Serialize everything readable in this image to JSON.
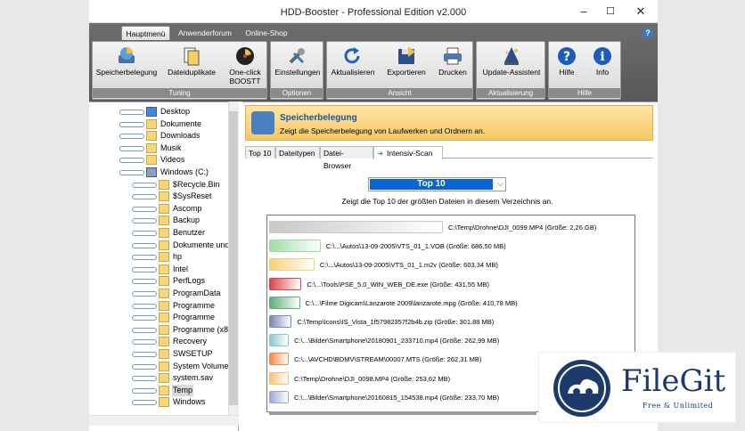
{
  "window": {
    "title": "HDD-Booster - Professional Edition v2.000",
    "minimize": "–",
    "maximize": "☐",
    "close": "✕"
  },
  "ribbon": {
    "tabs": [
      "Hauptmenü",
      "Anwenderforum",
      "Online-Shop"
    ],
    "help_glyph": "?",
    "groups": [
      {
        "label": "Tuning",
        "buttons": [
          {
            "label": "Speicherbelegung",
            "icon": "disk-usage-icon"
          },
          {
            "label": "Dateiduplikate",
            "icon": "duplicates-icon"
          },
          {
            "label": "One-click BOOSTT",
            "icon": "boost-icon"
          }
        ]
      },
      {
        "label": "Optionen",
        "buttons": [
          {
            "label": "Einstellungen",
            "icon": "wrench-icon"
          }
        ]
      },
      {
        "label": "Ansicht",
        "buttons": [
          {
            "label": "Aktualisieren",
            "icon": "refresh-icon"
          },
          {
            "label": "Exportieren",
            "icon": "export-icon"
          },
          {
            "label": "Drucken",
            "icon": "printer-icon"
          }
        ]
      },
      {
        "label": "Aktualisierung",
        "buttons": [
          {
            "label": "Update-Assistent",
            "icon": "update-wizard-icon"
          }
        ]
      },
      {
        "label": "Hilfe",
        "buttons": [
          {
            "label": "Hilfe",
            "icon": "help-icon"
          },
          {
            "label": "Info",
            "icon": "info-icon"
          }
        ]
      }
    ]
  },
  "tree": {
    "items": [
      "Desktop",
      "Dokumente",
      "Downloads",
      "Musik",
      "Videos",
      "Windows  (C:)",
      "$Recycle.Bin",
      "$SysReset",
      "Ascomp",
      "Backup",
      "Benutzer",
      "Dokumente und",
      "hp",
      "Intel",
      "PerfLogs",
      "ProgramData",
      "Programme",
      "Programme",
      "Programme (x86",
      "Recovery",
      "SWSETUP",
      "System Volume I",
      "system.sav",
      "Temp",
      "Windows"
    ],
    "selected": "Temp"
  },
  "banner": {
    "title": "Speicherbelegung",
    "subtitle": "Zeigt die Speicherbelegung von Laufwerken und Ordnern an."
  },
  "subtabs": [
    "Top 10",
    "Dateitypen",
    "Datei-Browser",
    "Intensiv-Scan"
  ],
  "combo": {
    "value": "Top 10",
    "arrow": "⌵"
  },
  "description": "Zeigt die Top 10 der größten Dateien in diesem Verzeichnis an.",
  "chart_data": {
    "type": "bar",
    "orientation": "horizontal",
    "unit_note": "Größe",
    "categories": [
      "C:\\Temp\\Drohne\\DJI_0099.MP4 (Größe: 2,26 GB)",
      "C:\\...\\Autos\\13-09-2005\\VTS_01_1.VOB (Größe: 686,50 MB)",
      "C:\\...\\Autos\\13-09-2005\\VTS_01_1.m2v (Größe: 603,34 MB)",
      "C:\\...\\Tools\\PSE_5.0_WIN_WEB_DE.exe (Größe: 431,55 MB)",
      "C:\\...\\Filme Digicam\\Lanzarote 2009\\lanzarote.mpg (Größe: 410,78 MB)",
      "C:\\Temp\\Icons\\IS_Vista_1f57982357f2b4b.zip (Größe: 301,88 MB)",
      "C:\\...\\Bilder\\Smartphone\\20180901_233710.mp4 (Größe: 262,99 MB)",
      "C:\\...\\AVCHD\\BDMV\\STREAM\\00007.MTS (Größe: 262,31 MB)",
      "C:\\Temp\\Drohne\\DJI_0098.MP4 (Größe: 253,62 MB)",
      "C:\\...\\Bilder\\Smartphone\\20160815_154538.mp4 (Größe: 233,70 MB)"
    ],
    "values_mb": [
      2314.24,
      686.5,
      603.34,
      431.55,
      410.78,
      301.88,
      262.99,
      262.31,
      253.62,
      233.7
    ],
    "colors": [
      "#c8c8c8",
      "#9fdca8",
      "#f5d27a",
      "#d9464a",
      "#5fae7a",
      "#7a86b8",
      "#8fc7d0",
      "#f08a4a",
      "#f5c27a",
      "#9aa8d8"
    ]
  },
  "watermark": {
    "name": "FileGit",
    "tagline": "Free & Unlimited"
  }
}
